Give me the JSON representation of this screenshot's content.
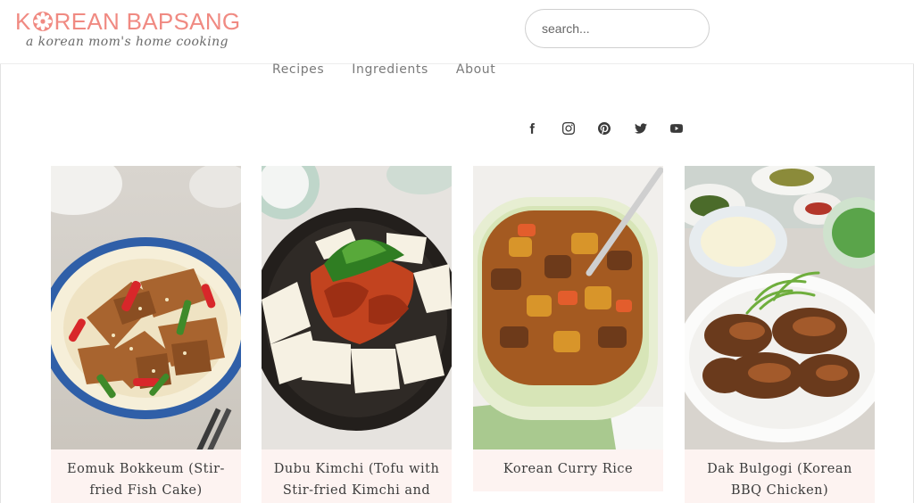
{
  "site": {
    "title_before": "K",
    "title_after": "REAN BAPSANG",
    "tagline": "a korean mom's home cooking",
    "brand_color": "#f08a82"
  },
  "search": {
    "placeholder": "search..."
  },
  "nav": {
    "items": [
      {
        "label": "Recipes"
      },
      {
        "label": "Ingredients"
      },
      {
        "label": "About"
      }
    ]
  },
  "social": {
    "icons": [
      "facebook-icon",
      "instagram-icon",
      "pinterest-icon",
      "twitter-icon",
      "youtube-icon"
    ]
  },
  "recipes": [
    {
      "title": "Eomuk Bokkeum (Stir-fried Fish Cake)"
    },
    {
      "title": "Dubu Kimchi (Tofu with Stir-fried Kimchi and"
    },
    {
      "title": "Korean Curry Rice"
    },
    {
      "title": "Dak Bulgogi (Korean BBQ Chicken)"
    }
  ]
}
